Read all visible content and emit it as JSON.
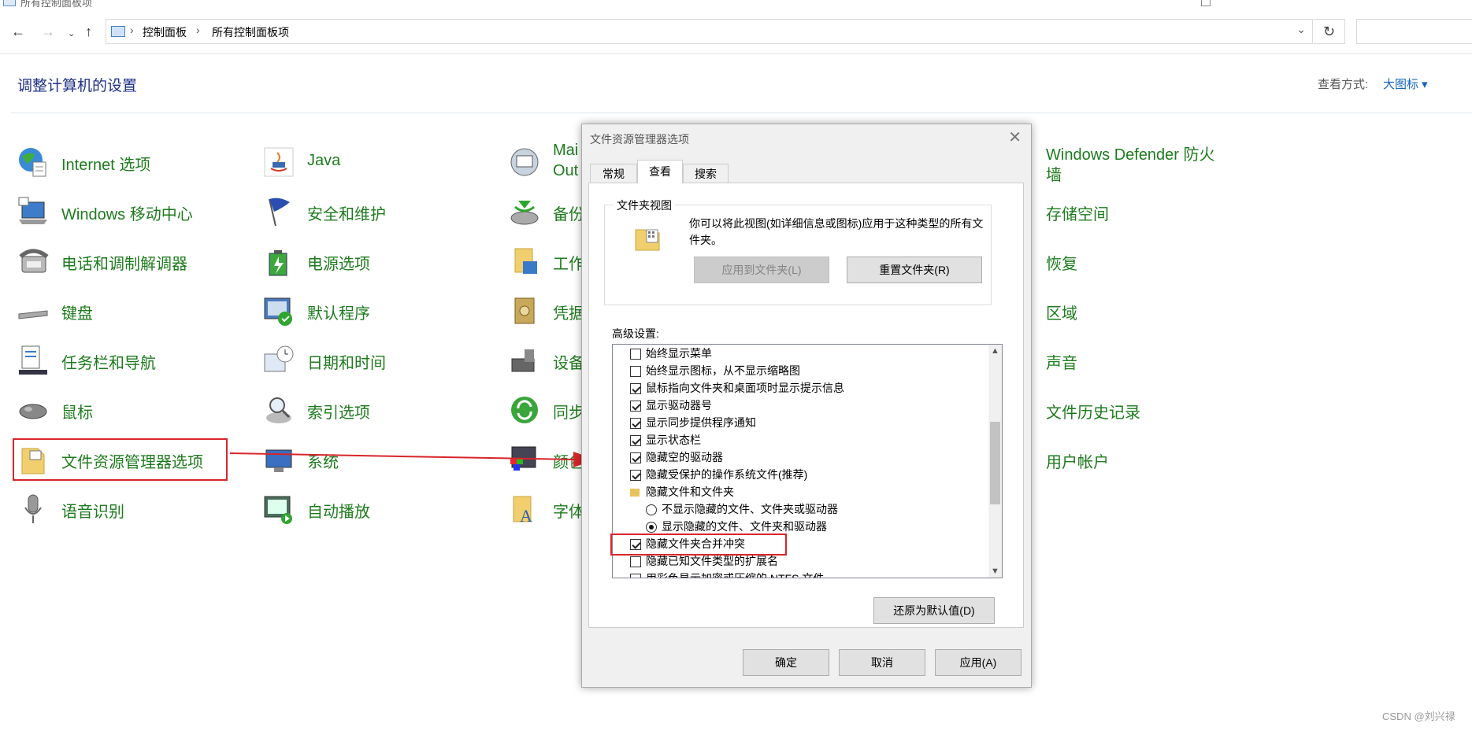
{
  "window": {
    "title": "所有控制面板项"
  },
  "address": {
    "root": "控制面板",
    "current": "所有控制面板项"
  },
  "header": {
    "title": "调整计算机的设置",
    "view_by_label": "查看方式:",
    "view_by_value": "大图标 ▾"
  },
  "items": {
    "internet": "Internet 选项",
    "java": "Java",
    "mail": "Mai",
    "mail2": "Out",
    "defender": "Windows Defender 防火",
    "defender2": "墙",
    "mobility": "Windows 移动中心",
    "security": "安全和维护",
    "backup": "备份",
    "storage": "存储空间",
    "phone": "电话和调制解调器",
    "power": "电源选项",
    "work": "工作",
    "recovery": "恢复",
    "keyboard": "键盘",
    "default": "默认程序",
    "cred": "凭据",
    "region": "区域",
    "taskbar": "任务栏和导航",
    "datetime": "日期和时间",
    "devices": "设备",
    "sound": "声音",
    "mouse": "鼠标",
    "index": "索引选项",
    "sync": "同步",
    "filehistory": "文件历史记录",
    "explorer": "文件资源管理器选项",
    "system": "系统",
    "color": "颜色",
    "user": "用户帐户",
    "speech": "语音识别",
    "autoplay": "自动播放",
    "font": "字体"
  },
  "dialog": {
    "title": "文件资源管理器选项",
    "tabs": [
      "常规",
      "查看",
      "搜索"
    ],
    "folder_view": {
      "legend": "文件夹视图",
      "text": "你可以将此视图(如详细信息或图标)应用于这种类型的所有文件夹。",
      "apply_btn": "应用到文件夹(L)",
      "reset_btn": "重置文件夹(R)"
    },
    "advanced_label": "高级设置:",
    "settings": [
      {
        "type": "checkbox",
        "checked": false,
        "label": "始终显示菜单"
      },
      {
        "type": "checkbox",
        "checked": false,
        "label": "始终显示图标，从不显示缩略图"
      },
      {
        "type": "checkbox",
        "checked": true,
        "label": "鼠标指向文件夹和桌面项时显示提示信息"
      },
      {
        "type": "checkbox",
        "checked": true,
        "label": "显示驱动器号"
      },
      {
        "type": "checkbox",
        "checked": true,
        "label": "显示同步提供程序通知"
      },
      {
        "type": "checkbox",
        "checked": true,
        "label": "显示状态栏"
      },
      {
        "type": "checkbox",
        "checked": true,
        "label": "隐藏空的驱动器"
      },
      {
        "type": "checkbox",
        "checked": true,
        "label": "隐藏受保护的操作系统文件(推荐)"
      },
      {
        "type": "folder",
        "label": "隐藏文件和文件夹"
      },
      {
        "type": "radio",
        "checked": false,
        "label": "不显示隐藏的文件、文件夹或驱动器"
      },
      {
        "type": "radio",
        "checked": true,
        "label": "显示隐藏的文件、文件夹和驱动器"
      },
      {
        "type": "checkbox",
        "checked": true,
        "label": "隐藏文件夹合并冲突"
      },
      {
        "type": "checkbox",
        "checked": false,
        "label": "隐藏已知文件类型的扩展名"
      },
      {
        "type": "checkbox",
        "checked": false,
        "label": "用彩色显示加密或压缩的 NTFS 文件"
      }
    ],
    "restore_btn": "还原为默认值(D)",
    "ok_btn": "确定",
    "cancel_btn": "取消",
    "apply_btn": "应用(A)"
  },
  "watermark": "CSDN @刘兴禄",
  "colors": {
    "link_green": "#1e7b1e",
    "header_blue": "#1e3287",
    "annotation_red": "#d9252b"
  }
}
